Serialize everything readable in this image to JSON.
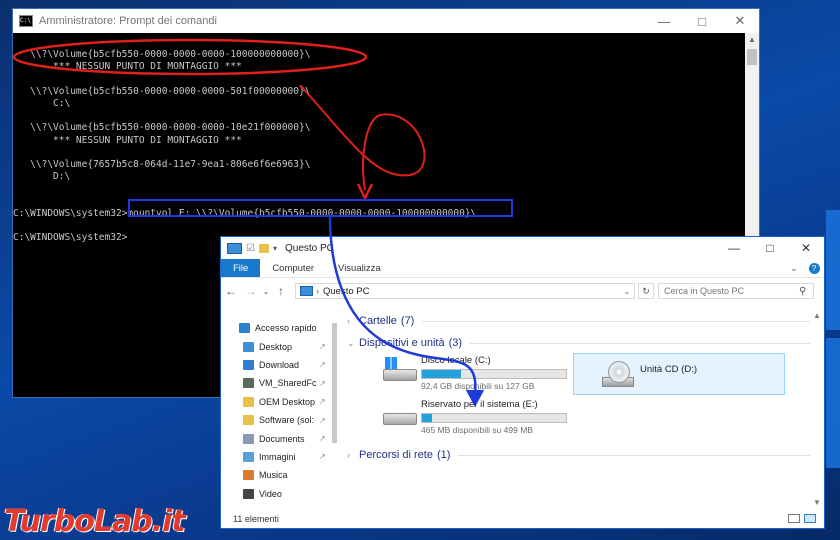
{
  "cmd": {
    "title": "Amministratore: Prompt dei comandi",
    "icon_text": "C:\\",
    "lines": [
      "",
      "   \\\\?\\Volume{b5cfb550-0000-0000-0000-100000000000}\\",
      "       *** NESSUN PUNTO DI MONTAGGIO ***",
      "",
      "   \\\\?\\Volume{b5cfb550-0000-0000-0000-501f00000000}\\",
      "       C:\\",
      "",
      "   \\\\?\\Volume{b5cfb550-0000-0000-0000-10e21f000000}\\",
      "       *** NESSUN PUNTO DI MONTAGGIO ***",
      "",
      "   \\\\?\\Volume{7657b5c8-064d-11e7-9ea1-806e6f6e6963}\\",
      "       D:\\",
      "",
      "",
      "C:\\WINDOWS\\system32>mountvol E: \\\\?\\Volume{b5cfb550-0000-0000-0000-100000000000}\\",
      "",
      "C:\\WINDOWS\\system32>"
    ]
  },
  "explorer": {
    "title": "Questo PC",
    "tabs": [
      "File",
      "Computer",
      "Visualizza"
    ],
    "address": "Questo PC",
    "search_placeholder": "Cerca in Questo PC",
    "sidebar": [
      {
        "label": "Accesso rapido",
        "icon": "star-icon",
        "color": "#2a7fd4",
        "pinned": false,
        "top": true
      },
      {
        "label": "Desktop",
        "icon": "desktop-icon",
        "color": "#3a8fd6",
        "pinned": true
      },
      {
        "label": "Download",
        "icon": "download-icon",
        "color": "#2f7bd0",
        "pinned": true
      },
      {
        "label": "VM_SharedFc",
        "icon": "network-drive-icon",
        "color": "#5a6a5a",
        "pinned": true
      },
      {
        "label": "OEM Desktop",
        "icon": "folder-icon",
        "color": "#e8c04a",
        "pinned": true
      },
      {
        "label": "Software (sol:",
        "icon": "folder-icon",
        "color": "#e8c04a",
        "pinned": true
      },
      {
        "label": "Documents",
        "icon": "documents-icon",
        "color": "#8a9ab0",
        "pinned": true
      },
      {
        "label": "Immagini",
        "icon": "pictures-icon",
        "color": "#5aa0d8",
        "pinned": true
      },
      {
        "label": "Musica",
        "icon": "music-icon",
        "color": "#d97a2a",
        "pinned": false
      },
      {
        "label": "Video",
        "icon": "video-icon",
        "color": "#444",
        "pinned": false
      }
    ],
    "groups": {
      "folders": {
        "label": "Cartelle",
        "count": "(7)"
      },
      "devices": {
        "label": "Dispositivi e unità",
        "count": "(3)"
      },
      "network": {
        "label": "Percorsi di rete",
        "count": "(1)"
      }
    },
    "drives": [
      {
        "name": "Disco locale (C:)",
        "free": "92,4 GB disponibili su 127 GB",
        "used_fraction": 0.27
      },
      {
        "name": "Riservato per il sistema (E:)",
        "free": "465 MB disponibili su 499 MB",
        "used_fraction": 0.07
      }
    ],
    "cd": {
      "name": "Unità CD (D:)"
    },
    "status": "11 elementi"
  },
  "colors": {
    "accent": "#1979ca",
    "annotation_red": "#e0201a",
    "annotation_blue": "#1e3ad8"
  },
  "watermark": "TurboLab.it"
}
